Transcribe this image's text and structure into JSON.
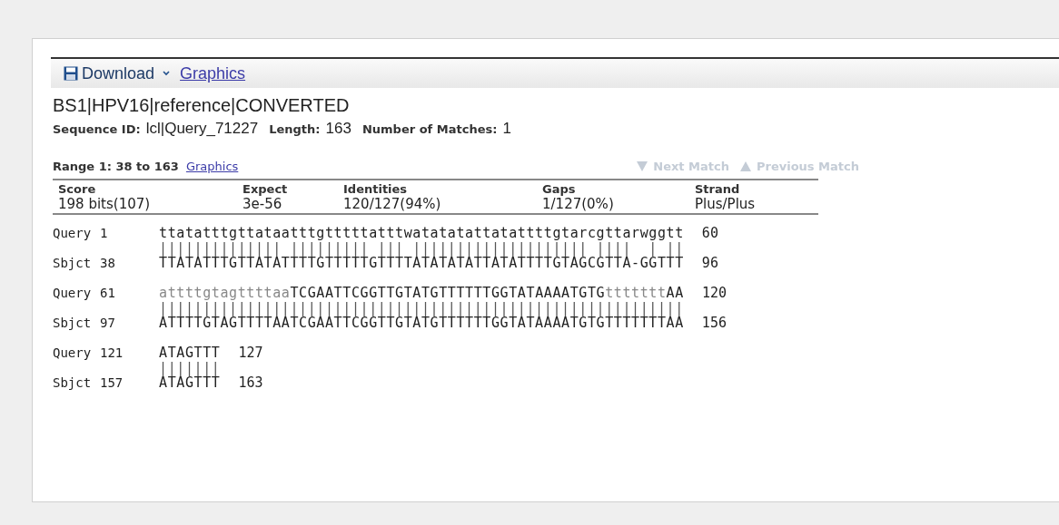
{
  "toolbar": {
    "download": "Download",
    "graphics": "Graphics"
  },
  "title": "BS1|HPV16|reference|CONVERTED",
  "meta": [
    {
      "label": "Sequence ID:",
      "value": "lcl|Query_71227"
    },
    {
      "label": "Length:",
      "value": "163"
    },
    {
      "label": "Number of Matches:",
      "value": "1"
    }
  ],
  "range": {
    "label": "Range 1: 38 to 163",
    "link": "Graphics",
    "next": "Next Match",
    "previous": "Previous Match",
    "next_disabled": true,
    "previous_disabled": true
  },
  "stats": {
    "columns": [
      "Score",
      "Expect",
      "Identities",
      "Gaps",
      "Strand"
    ],
    "values": [
      "198 bits(107)",
      "3e-56",
      "120/127(94%)",
      "1/127(0%)",
      "Plus/Plus"
    ]
  },
  "alignment": [
    {
      "query_label": "Query",
      "query_start": "1",
      "query": [
        {
          "text": "ttatatttgttataatttgtttttatttwatatatattatattttgtarcgttarwggtt",
          "masked": false
        }
      ],
      "query_end": "60",
      "midline": "|||||||||||||| ||||||||| ||| |||||||||||||||||||| ||||  | ||",
      "sbjct_label": "Sbjct",
      "sbjct_start": "38",
      "sbjct": "TTATATTTGTTATATTTTGTTTTTGTTTTATATATATTATATTTTGTAGCGTTA-GGTTT",
      "sbjct_end": "96"
    },
    {
      "query_label": "Query",
      "query_start": "61",
      "query": [
        {
          "text": "attttgtagttttaa",
          "masked": true
        },
        {
          "text": "TCGAATTCGGTTGTATGTTTTTTGGTATAAAATGTG",
          "masked": false
        },
        {
          "text": "ttttttt",
          "masked": true
        },
        {
          "text": "AA",
          "masked": false
        }
      ],
      "query_end": "120",
      "midline": "||||||||||||||||||||||||||||||||||||||||||||||||||||||||||||",
      "sbjct_label": "Sbjct",
      "sbjct_start": "97",
      "sbjct": "ATTTTGTAGTTTTAATCGAATTCGGTTGTATGTTTTTTGGTATAAAATGTGTTTTTTTAA",
      "sbjct_end": "156"
    },
    {
      "query_label": "Query",
      "query_start": "121",
      "query": [
        {
          "text": "ATAGTTT",
          "masked": false
        }
      ],
      "query_end": "127",
      "midline": "|||||||",
      "sbjct_label": "Sbjct",
      "sbjct_start": "157",
      "sbjct": "ATAGTTT",
      "sbjct_end": "163"
    }
  ]
}
